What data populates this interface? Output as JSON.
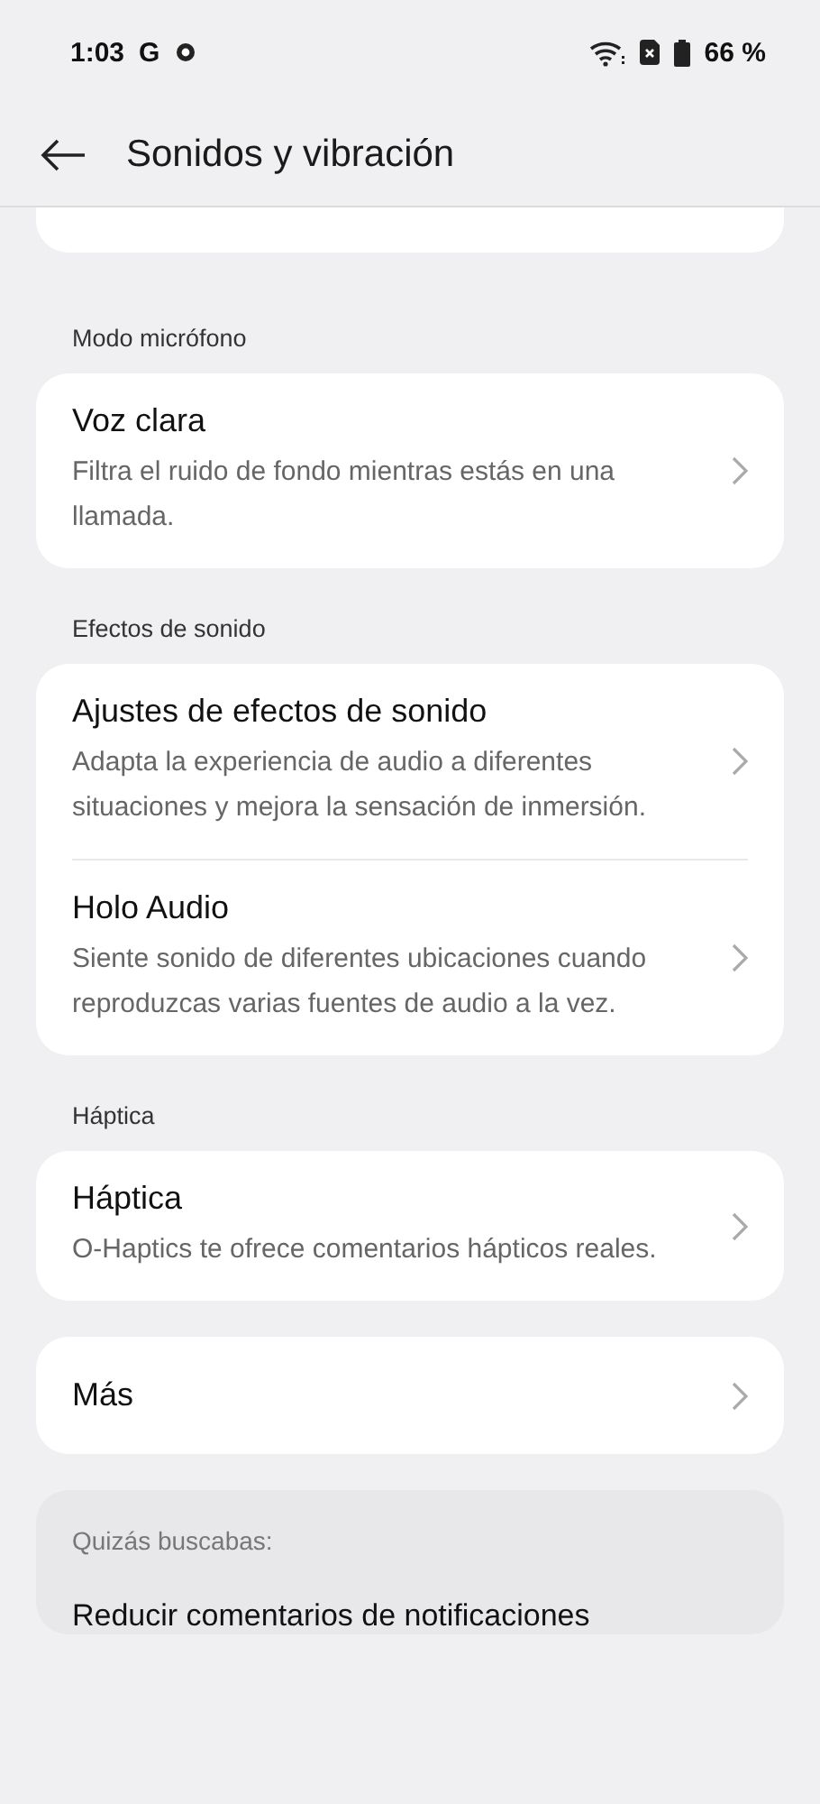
{
  "status_bar": {
    "time": "1:03",
    "notification_letter": "G",
    "battery": "66 %"
  },
  "header": {
    "title": "Sonidos y vibración"
  },
  "sections": [
    {
      "title": "Modo micrófono",
      "items": [
        {
          "title": "Voz clara",
          "description": "Filtra el ruido de fondo mientras estás en una llamada."
        }
      ]
    },
    {
      "title": "Efectos de sonido",
      "items": [
        {
          "title": "Ajustes de efectos de sonido",
          "description": "Adapta la experiencia de audio a diferentes situaciones y mejora la sensación de inmersión."
        },
        {
          "title": "Holo Audio",
          "description": "Siente sonido de diferentes ubicaciones cuando reproduzcas varias fuentes de audio a la vez."
        }
      ]
    },
    {
      "title": "Háptica",
      "items": [
        {
          "title": "Háptica",
          "description": "O-Haptics te ofrece comentarios hápticos reales."
        }
      ]
    },
    {
      "items": [
        {
          "title": "Más"
        }
      ]
    }
  ],
  "suggestions": {
    "title": "Quizás buscabas:",
    "items": [
      "Reducir comentarios de notificaciones"
    ]
  }
}
